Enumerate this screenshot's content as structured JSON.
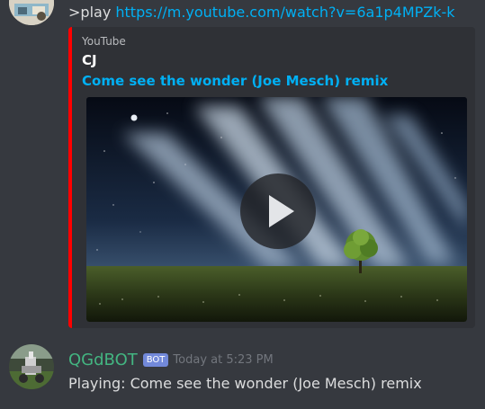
{
  "message_1": {
    "command": ">play ",
    "link": "https://m.youtube.com/watch?v=6a1p4MPZk-k"
  },
  "embed": {
    "provider": "YouTube",
    "author": "CJ",
    "title": "Come see the wonder (Joe Mesch) remix",
    "accent_color": "#ff0000",
    "thumbnail_icon": "play-icon"
  },
  "message_2": {
    "author": "QGdBOT",
    "badge": "BOT",
    "timestamp": "Today at 5:23 PM",
    "text": "Playing: Come see the wonder (Joe Mesch) remix",
    "name_color": "#43b581",
    "badge_color": "#7289da"
  }
}
